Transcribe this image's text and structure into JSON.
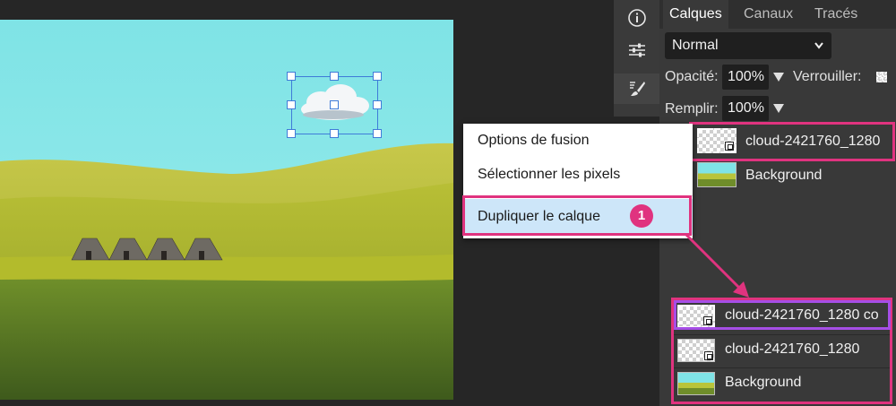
{
  "tools": {
    "info_icon": "info-icon",
    "adjust_icon": "sliders-icon",
    "brush_icon": "brush-settings-icon"
  },
  "panel": {
    "tabs": [
      "Calques",
      "Canaux",
      "Tracés"
    ],
    "active_tab": "Calques",
    "blend_mode": "Normal",
    "opacity_label": "Opacité:",
    "opacity_value": "100%",
    "lock_label": "Verrouiller:",
    "fill_label": "Remplir:",
    "fill_value": "100%",
    "layers": [
      {
        "name": "cloud-2421760_1280",
        "type": "smart-object"
      },
      {
        "name": "Background",
        "type": "image"
      }
    ]
  },
  "context_menu": {
    "items": [
      "Options de fusion",
      "Sélectionner les pixels",
      "Dupliquer le calque"
    ],
    "highlighted": "Dupliquer le calque"
  },
  "annotation": {
    "step": "1",
    "color": "#e0337f",
    "result_highlight_color": "#a64ee6"
  },
  "result_layers": [
    {
      "name": "cloud-2421760_1280 co"
    },
    {
      "name": "cloud-2421760_1280"
    },
    {
      "name": "Background"
    }
  ]
}
